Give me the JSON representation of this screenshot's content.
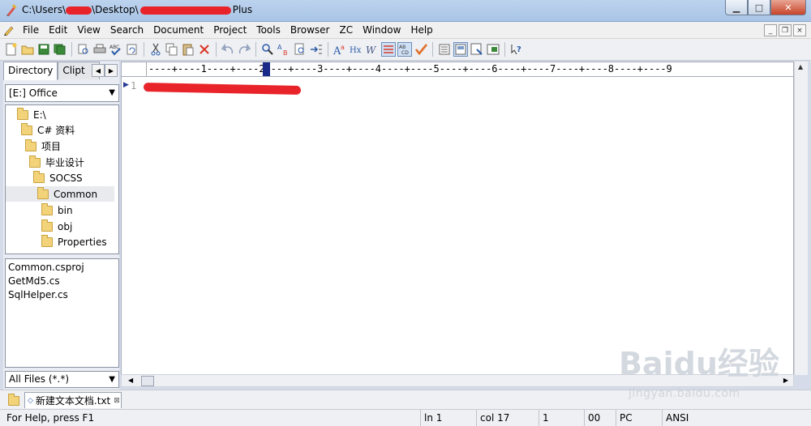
{
  "window": {
    "title_parts": [
      "C:\\Users\\",
      "\\Desktop\\",
      "Plus"
    ],
    "minimize_glyph": "▁",
    "maximize_glyph": "□",
    "close_glyph": "✕"
  },
  "menu": [
    "File",
    "Edit",
    "View",
    "Search",
    "Document",
    "Project",
    "Tools",
    "Browser",
    "ZC",
    "Window",
    "Help"
  ],
  "mdi_buttons": [
    "_",
    "❐",
    "×"
  ],
  "left_panel": {
    "tabs": [
      "Directory",
      "Clipt"
    ],
    "tab_scroll_left": "◀",
    "tab_scroll_right": "▶",
    "drive": "[E:] Office",
    "dropdown_glyph": "▼",
    "tree": [
      {
        "label": "E:\\",
        "level": 0,
        "selected": false
      },
      {
        "label": "C# 资料",
        "level": 1,
        "selected": false
      },
      {
        "label": "项目",
        "level": 2,
        "selected": false
      },
      {
        "label": "毕业设计",
        "level": 3,
        "selected": false
      },
      {
        "label": "SOCSS",
        "level": 4,
        "selected": false
      },
      {
        "label": "Common",
        "level": 5,
        "selected": true
      },
      {
        "label": "bin",
        "level": 6,
        "selected": false
      },
      {
        "label": "obj",
        "level": 6,
        "selected": false
      },
      {
        "label": "Properties",
        "level": 6,
        "selected": false
      }
    ],
    "files": [
      "Common.csproj",
      "GetMd5.cs",
      "SqlHelper.cs"
    ],
    "filter": "All Files (*.*)"
  },
  "editor": {
    "ruler": "----+----1----+----2----+----3----+----4----+----5----+----6----+----7----+----8----+----9",
    "line_number": "1",
    "line_arrow": "▶"
  },
  "scroll_glyphs": {
    "up": "▲",
    "left": "◀",
    "right": "▶"
  },
  "document_tab": {
    "name": "新建文本文档.txt",
    "modified_glyph": "◇",
    "close_glyph": "⊠"
  },
  "status": {
    "help": "For Help, press F1",
    "line": "ln 1",
    "col": "col 17",
    "num": "1",
    "code": "00",
    "platform": "PC",
    "encoding": "ANSI"
  },
  "watermark": {
    "logo": "Baidu经验",
    "url": "jingyan.baidu.com"
  },
  "colors": {
    "redaction": "#e8242a",
    "ruler_cursor": "#1a2a88",
    "folder": "#f3d37a"
  }
}
